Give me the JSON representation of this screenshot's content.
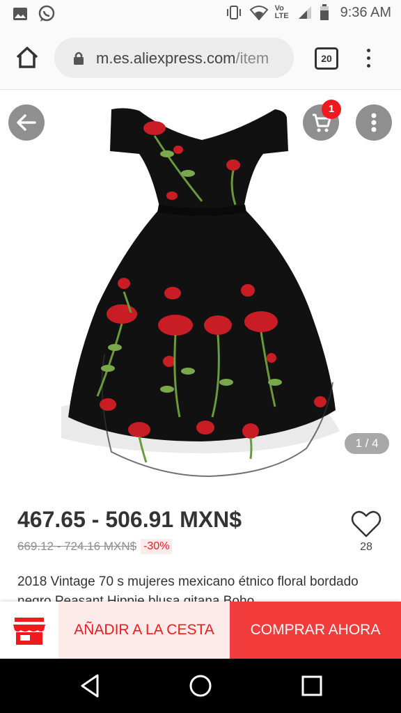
{
  "status_bar": {
    "time": "9:36 AM",
    "icons": [
      "image-icon",
      "whatsapp-icon",
      "vibrate-icon",
      "wifi-icon",
      "volte-icon",
      "signal-icon",
      "battery-icon"
    ],
    "volte_label": "Vo LTE"
  },
  "browser": {
    "url_host": "m.es.aliexpress.com",
    "url_path": "/item",
    "tab_count": "20"
  },
  "product": {
    "cart_badge": "1",
    "image_counter": "1 / 4",
    "price": "467.65 - 506.91 MXN$",
    "old_price": "669.12 - 724.16 MXN$",
    "discount": "-30%",
    "wishlist_count": "28",
    "title": "2018 Vintage 70 s mujeres mexicano étnico floral bordado negro Peasant Hippie blusa gitana Boho"
  },
  "actions": {
    "add_to_cart": "AÑADIR A LA CESTA",
    "buy_now": "COMPRAR AHORA"
  },
  "colors": {
    "accent_red": "#f0191e",
    "buy_bg": "#f23b3b",
    "cart_bg": "#fdebea"
  }
}
